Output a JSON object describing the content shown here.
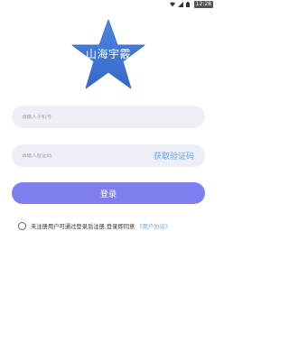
{
  "status_bar": {
    "time": "12:28",
    "icons": [
      "wifi-icon",
      "signal-icon",
      "battery-icon"
    ]
  },
  "logo": {
    "text": "山海宇霰",
    "colors": {
      "star": "#3f78d6"
    }
  },
  "phone": {
    "placeholder": "请输入手机号",
    "value": ""
  },
  "code": {
    "placeholder": "请输入验证码",
    "value": "",
    "get_code_label": "获取验证码"
  },
  "login": {
    "label": "登录",
    "color": "#7f7ef0"
  },
  "agreement": {
    "checked": false,
    "text": "未注册用户可通过登录后注册,登录即同意",
    "link_label": "《用户协议》",
    "link_color": "#6aa5e8"
  }
}
